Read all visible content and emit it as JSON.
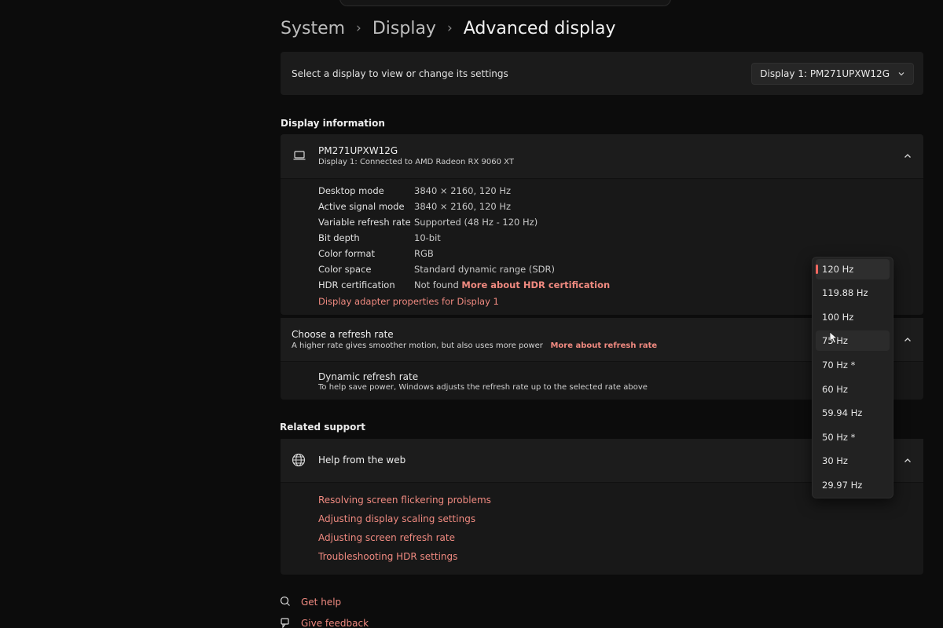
{
  "breadcrumb": {
    "items": [
      "System",
      "Display",
      "Advanced display"
    ]
  },
  "display_select": {
    "prompt": "Select a display to view or change its settings",
    "selected": "Display 1: PM271UPXW12G"
  },
  "display_info": {
    "section_title": "Display information",
    "name": "PM271UPXW12G",
    "subtitle": "Display 1: Connected to AMD Radeon RX 9060 XT",
    "rows": [
      {
        "label": "Desktop mode",
        "value": "3840 × 2160, 120 Hz"
      },
      {
        "label": "Active signal mode",
        "value": "3840 × 2160, 120 Hz"
      },
      {
        "label": "Variable refresh rate",
        "value": "Supported (48 Hz - 120 Hz)"
      },
      {
        "label": "Bit depth",
        "value": "10-bit"
      },
      {
        "label": "Color format",
        "value": "RGB"
      },
      {
        "label": "Color space",
        "value": "Standard dynamic range (SDR)"
      },
      {
        "label": "HDR certification",
        "value": "Not found",
        "link": "More about HDR certification"
      }
    ],
    "adapter_link": "Display adapter properties for Display 1"
  },
  "refresh": {
    "title": "Choose a refresh rate",
    "subtitle": "A higher rate gives smoother motion, but also uses more power",
    "link": "More about refresh rate",
    "dynamic_title": "Dynamic refresh rate",
    "dynamic_subtitle": "To help save power, Windows adjusts the refresh rate up to the selected rate above",
    "options": [
      "120 Hz",
      "119.88 Hz",
      "100 Hz",
      "75 Hz",
      "70 Hz *",
      "60 Hz",
      "59.94 Hz",
      "50 Hz *",
      "30 Hz",
      "29.97 Hz"
    ],
    "selected_index": 0
  },
  "support": {
    "section_title": "Related support",
    "title": "Help from the web",
    "links": [
      "Resolving screen flickering problems",
      "Adjusting display scaling settings",
      "Adjusting screen refresh rate",
      "Troubleshooting HDR settings"
    ]
  },
  "footer": {
    "get_help": "Get help",
    "give_feedback": "Give feedback"
  },
  "colors": {
    "accent": "#f08a80",
    "background": "#0c0c0c",
    "card": "#1b1b1b"
  }
}
